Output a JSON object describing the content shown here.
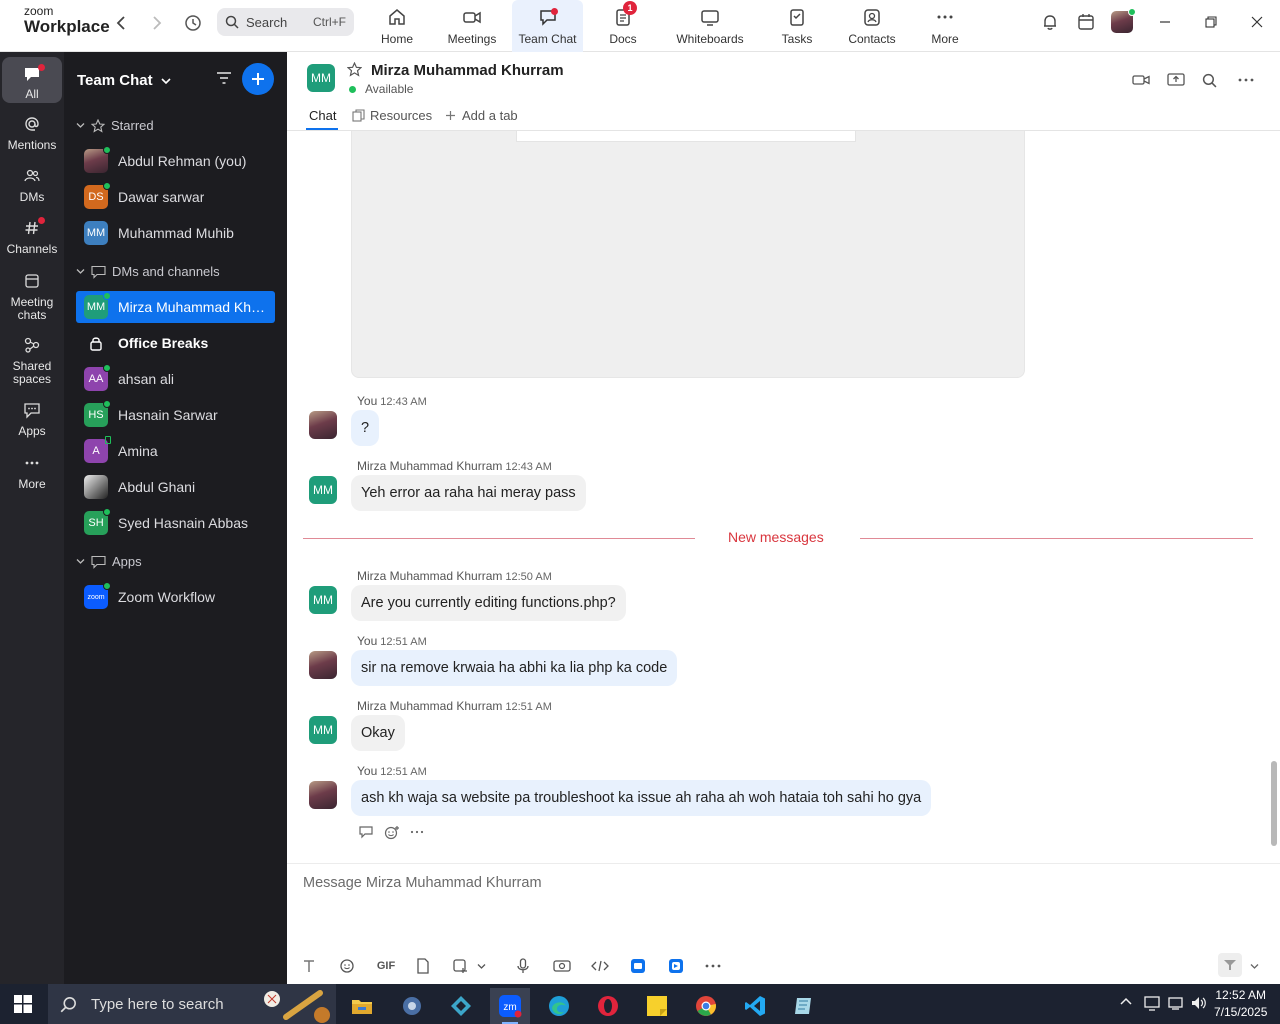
{
  "app": {
    "logo_line1": "zoom",
    "logo_line2": "Workplace"
  },
  "search": {
    "label": "Search",
    "shortcut": "Ctrl+F"
  },
  "tabs": [
    {
      "label": "Home",
      "icon": "home-icon"
    },
    {
      "label": "Meetings",
      "icon": "video-icon"
    },
    {
      "label": "Team Chat",
      "icon": "chat-icon"
    },
    {
      "label": "Docs",
      "icon": "docs-icon",
      "badge": "1"
    },
    {
      "label": "Whiteboards",
      "icon": "whiteboard-icon"
    },
    {
      "label": "Tasks",
      "icon": "tasks-icon"
    },
    {
      "label": "Contacts",
      "icon": "contacts-icon"
    },
    {
      "label": "More",
      "icon": "more-icon"
    }
  ],
  "rail": [
    {
      "label": "All"
    },
    {
      "label": "Mentions"
    },
    {
      "label": "DMs"
    },
    {
      "label": "Channels"
    },
    {
      "label": "Meeting chats"
    },
    {
      "label": "Shared spaces"
    },
    {
      "label": "Apps"
    },
    {
      "label": "More"
    }
  ],
  "sidebar": {
    "title": "Team Chat",
    "starred_label": "Starred",
    "starred": [
      {
        "initials": "",
        "name": "Abdul Rehman (you)",
        "color": "#7a4a5a",
        "photo": true
      },
      {
        "initials": "DS",
        "name": "Dawar sarwar",
        "color": "#d2691e"
      },
      {
        "initials": "MM",
        "name": "Muhammad Muhib",
        "color": "#3d7fbf"
      }
    ],
    "dms_label": "DMs and channels",
    "dms": [
      {
        "initials": "MM",
        "name": "Mirza Muhammad Khurram",
        "color": "#1f9d7a",
        "selected": true
      },
      {
        "initials": "",
        "name": "Office Breaks",
        "lock": true,
        "bold": true
      },
      {
        "initials": "AA",
        "name": "ahsan ali",
        "color": "#8e44ad"
      },
      {
        "initials": "HS",
        "name": "Hasnain Sarwar",
        "color": "#27a05a"
      },
      {
        "initials": "A",
        "name": "Amina",
        "color": "#8e44ad"
      },
      {
        "initials": "",
        "name": "Abdul Ghani",
        "color": "#d8d8d8",
        "photo": true
      },
      {
        "initials": "SH",
        "name": "Syed Hasnain Abbas",
        "color": "#27a05a"
      }
    ],
    "apps_label": "Apps",
    "apps": [
      {
        "initials": "zoom",
        "name": "Zoom Workflow",
        "color": "#0b5cff"
      }
    ]
  },
  "chat": {
    "contact_initials": "MM",
    "contact_name": "Mirza Muhammad Khurram",
    "status": "Available",
    "tabs": [
      "Chat",
      "Resources",
      "Add a tab"
    ],
    "new_messages_label": "New messages",
    "messages": [
      {
        "sender": "You",
        "time": "12:43 AM",
        "text": "?",
        "mine": true
      },
      {
        "sender": "Mirza Muhammad Khurram",
        "time": "12:43 AM",
        "text": "Yeh error aa raha hai meray pass",
        "mine": false
      },
      {
        "sender": "Mirza Muhammad Khurram",
        "time": "12:50 AM",
        "text": "Are you currently editing functions.php?",
        "mine": false
      },
      {
        "sender": "You",
        "time": "12:51 AM",
        "text": "sir na remove krwaia ha abhi ka lia php ka code",
        "mine": true
      },
      {
        "sender": "Mirza Muhammad Khurram",
        "time": "12:51 AM",
        "text": "Okay",
        "mine": false
      },
      {
        "sender": "You",
        "time": "12:51 AM",
        "text": "ash kh waja sa website pa troubleshoot ka issue ah raha ah woh hataia toh sahi ho gya",
        "mine": true
      }
    ]
  },
  "composer": {
    "placeholder": "Message Mirza Muhammad Khurram",
    "gif_label": "GIF"
  },
  "taskbar": {
    "search_placeholder": "Type here to search",
    "time": "12:52 AM",
    "date": "7/15/2025"
  },
  "colors": {
    "accent": "#0e72ed",
    "presence": "#1fbf5b",
    "alert": "#e0243c",
    "new_messages": "#d9363e"
  }
}
